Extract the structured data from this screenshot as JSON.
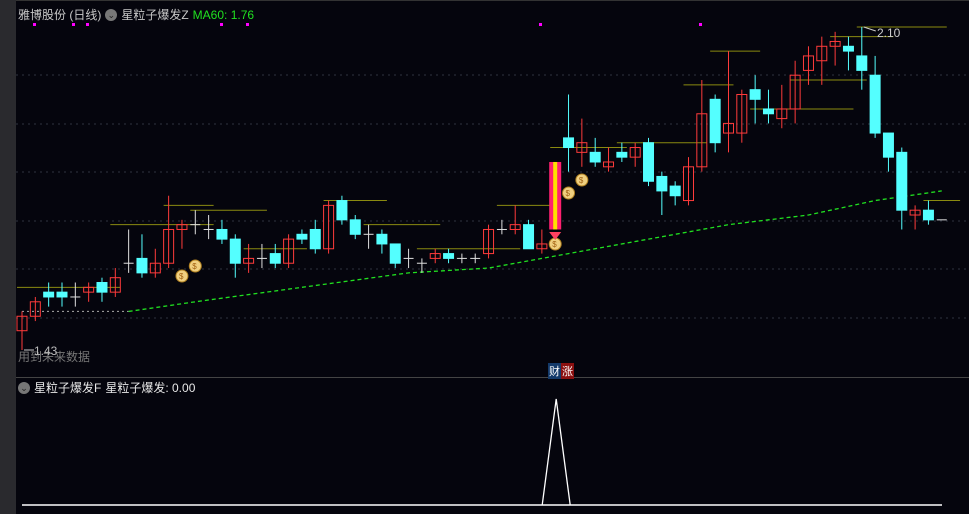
{
  "header": {
    "stock_name": "雅博股份 (日线)",
    "indicator_name": "星粒子爆发Z",
    "ma_label": "MA60: 1.76"
  },
  "price_labels": {
    "high": "2.10",
    "low": "1.43",
    "no_future": "用到未来数据"
  },
  "signal_badge": {
    "left": "财",
    "right": "涨"
  },
  "sub_panel": {
    "indicator_name": "星粒子爆发F",
    "value_label": "星粒子爆发: 0.00"
  },
  "colors": {
    "up": "#ff3b3b",
    "down": "#54ffff",
    "ma60": "#20e020",
    "resistance": "#8a8a10",
    "signal_dot": "#ff00ff"
  },
  "chart_data": {
    "type": "candlestick",
    "price_range": [
      1.43,
      2.1
    ],
    "ohlc": [
      [
        1.47,
        1.5,
        1.51,
        1.43
      ],
      [
        1.5,
        1.53,
        1.54,
        1.49
      ],
      [
        1.55,
        1.54,
        1.57,
        1.52
      ],
      [
        1.55,
        1.54,
        1.57,
        1.52
      ],
      [
        1.54,
        1.54,
        1.57,
        1.52
      ],
      [
        1.55,
        1.56,
        1.57,
        1.53
      ],
      [
        1.57,
        1.55,
        1.58,
        1.53
      ],
      [
        1.55,
        1.58,
        1.6,
        1.54
      ],
      [
        1.61,
        1.61,
        1.68,
        1.59
      ],
      [
        1.62,
        1.59,
        1.67,
        1.58
      ],
      [
        1.59,
        1.61,
        1.64,
        1.58
      ],
      [
        1.61,
        1.68,
        1.75,
        1.6
      ],
      [
        1.68,
        1.69,
        1.7,
        1.64
      ],
      [
        1.69,
        1.69,
        1.72,
        1.67
      ],
      [
        1.68,
        1.68,
        1.71,
        1.66
      ],
      [
        1.68,
        1.66,
        1.7,
        1.65
      ],
      [
        1.66,
        1.61,
        1.67,
        1.58
      ],
      [
        1.61,
        1.62,
        1.65,
        1.59
      ],
      [
        1.62,
        1.62,
        1.65,
        1.6
      ],
      [
        1.63,
        1.61,
        1.65,
        1.6
      ],
      [
        1.61,
        1.66,
        1.67,
        1.6
      ],
      [
        1.67,
        1.66,
        1.68,
        1.65
      ],
      [
        1.68,
        1.64,
        1.7,
        1.63
      ],
      [
        1.64,
        1.73,
        1.74,
        1.63
      ],
      [
        1.74,
        1.7,
        1.75,
        1.69
      ],
      [
        1.7,
        1.67,
        1.71,
        1.66
      ],
      [
        1.67,
        1.67,
        1.69,
        1.64
      ],
      [
        1.67,
        1.65,
        1.68,
        1.63
      ],
      [
        1.65,
        1.61,
        1.65,
        1.6
      ],
      [
        1.62,
        1.62,
        1.64,
        1.6
      ],
      [
        1.61,
        1.61,
        1.62,
        1.59
      ],
      [
        1.62,
        1.63,
        1.64,
        1.61
      ],
      [
        1.63,
        1.62,
        1.64,
        1.61
      ],
      [
        1.62,
        1.62,
        1.63,
        1.61
      ],
      [
        1.62,
        1.62,
        1.63,
        1.61
      ],
      [
        1.63,
        1.68,
        1.69,
        1.62
      ],
      [
        1.68,
        1.68,
        1.7,
        1.67
      ],
      [
        1.68,
        1.69,
        1.73,
        1.67
      ],
      [
        1.69,
        1.64,
        1.7,
        1.64
      ],
      [
        1.64,
        1.65,
        1.68,
        1.63
      ],
      [
        1.68,
        1.82,
        1.82,
        1.68
      ],
      [
        1.87,
        1.85,
        1.96,
        1.8
      ],
      [
        1.84,
        1.86,
        1.91,
        1.81
      ],
      [
        1.84,
        1.82,
        1.87,
        1.81
      ],
      [
        1.81,
        1.82,
        1.85,
        1.8
      ],
      [
        1.84,
        1.83,
        1.86,
        1.82
      ],
      [
        1.83,
        1.85,
        1.86,
        1.81
      ],
      [
        1.86,
        1.78,
        1.87,
        1.77
      ],
      [
        1.79,
        1.76,
        1.8,
        1.71
      ],
      [
        1.77,
        1.75,
        1.78,
        1.73
      ],
      [
        1.74,
        1.81,
        1.83,
        1.73
      ],
      [
        1.81,
        1.92,
        1.99,
        1.8
      ],
      [
        1.95,
        1.86,
        1.96,
        1.84
      ],
      [
        1.88,
        1.9,
        2.05,
        1.84
      ],
      [
        1.88,
        1.96,
        1.97,
        1.86
      ],
      [
        1.97,
        1.95,
        2.0,
        1.9
      ],
      [
        1.93,
        1.92,
        1.97,
        1.9
      ],
      [
        1.91,
        1.93,
        1.98,
        1.89
      ],
      [
        1.93,
        2.0,
        2.03,
        1.9
      ],
      [
        2.01,
        2.04,
        2.06,
        1.98
      ],
      [
        2.03,
        2.06,
        2.08,
        1.98
      ],
      [
        2.06,
        2.07,
        2.09,
        2.02
      ],
      [
        2.06,
        2.05,
        2.08,
        2.01
      ],
      [
        2.04,
        2.01,
        2.1,
        1.97
      ],
      [
        2.0,
        1.88,
        2.04,
        1.87
      ],
      [
        1.88,
        1.83,
        1.88,
        1.8
      ],
      [
        1.84,
        1.72,
        1.85,
        1.68
      ],
      [
        1.71,
        1.72,
        1.73,
        1.68
      ],
      [
        1.72,
        1.7,
        1.74,
        1.69
      ],
      [
        1.7,
        1.7,
        1.7,
        1.7
      ]
    ],
    "limit_up_index": 40,
    "money_bag_indices": [
      12,
      11,
      40,
      41,
      42
    ],
    "signal_dot_indices": [
      1,
      4,
      5,
      15,
      17,
      39,
      51
    ],
    "ma60": {
      "start_index": 8,
      "points": [
        [
          8,
          1.51
        ],
        [
          13,
          1.53
        ],
        [
          21,
          1.56
        ],
        [
          29,
          1.59
        ],
        [
          35,
          1.6
        ],
        [
          41,
          1.63
        ],
        [
          47,
          1.66
        ],
        [
          53,
          1.69
        ],
        [
          59,
          1.71
        ],
        [
          64,
          1.74
        ],
        [
          69,
          1.76
        ]
      ]
    },
    "resistance_lines": [
      [
        0,
        7,
        1.56
      ],
      [
        7,
        14,
        1.69
      ],
      [
        11,
        14,
        1.73
      ],
      [
        13,
        18,
        1.72
      ],
      [
        17,
        21,
        1.64
      ],
      [
        23,
        27,
        1.74
      ],
      [
        26,
        31,
        1.69
      ],
      [
        30,
        37,
        1.64
      ],
      [
        36,
        40,
        1.73
      ],
      [
        40,
        45,
        1.85
      ],
      [
        45,
        51,
        1.86
      ],
      [
        50,
        53,
        1.98
      ],
      [
        52,
        55,
        2.05
      ],
      [
        55,
        62,
        1.93
      ],
      [
        58,
        63,
        1.99
      ],
      [
        61,
        65,
        2.08
      ],
      [
        63,
        69,
        2.1
      ],
      [
        68,
        70,
        1.74
      ]
    ],
    "sub_indicator": {
      "values_nonzero": [
        [
          40,
          1.0
        ]
      ],
      "ylim": [
        0,
        1
      ]
    }
  }
}
